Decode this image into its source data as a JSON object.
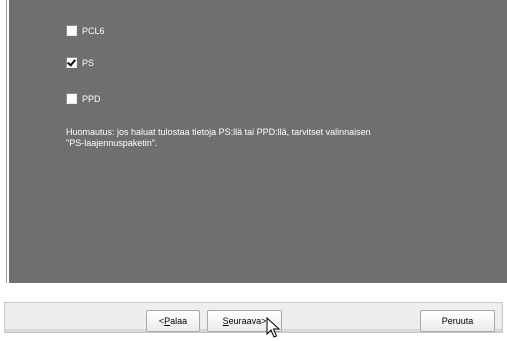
{
  "options": [
    {
      "label": "PCL6",
      "checked": false
    },
    {
      "label": "PS",
      "checked": true
    },
    {
      "label": "PPD",
      "checked": false
    }
  ],
  "note": {
    "line1": "Huomautus: jos haluat tulostaa tietoja PS:llä tai PPD:llä, tarvitset valinnaisen",
    "line2": "\"PS-laajennuspaketin\"."
  },
  "buttons": {
    "back_prefix": "< ",
    "back_key": "P",
    "back_rest": "alaa",
    "next_key": "S",
    "next_rest": "euraava",
    "next_suffix": " >",
    "cancel": "Peruuta"
  },
  "colors": {
    "panel": "#6f6f6f",
    "text": "#ffffff"
  }
}
